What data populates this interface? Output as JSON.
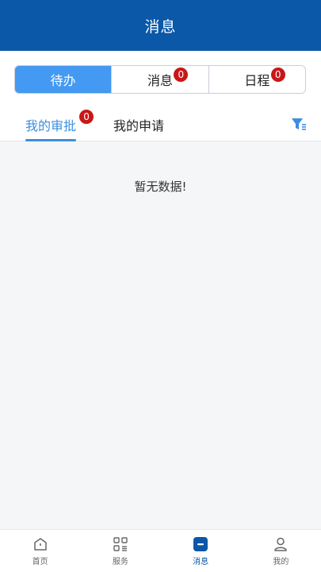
{
  "header": {
    "title": "消息"
  },
  "segments": [
    {
      "label": "待办",
      "badge": ""
    },
    {
      "label": "消息",
      "badge": "0"
    },
    {
      "label": "日程",
      "badge": "0"
    }
  ],
  "subtabs": [
    {
      "label": "我的审批",
      "badge": "0"
    },
    {
      "label": "我的申请",
      "badge": ""
    }
  ],
  "content": {
    "empty_text": "暂无数据!"
  },
  "tabbar": [
    {
      "label": "首页",
      "icon": "home-icon"
    },
    {
      "label": "服务",
      "icon": "grid-icon"
    },
    {
      "label": "消息",
      "icon": "message-icon"
    },
    {
      "label": "我的",
      "icon": "profile-icon"
    }
  ],
  "colors": {
    "primary": "#0b57a8",
    "active_tab": "#4499f2",
    "badge": "#c81717"
  }
}
